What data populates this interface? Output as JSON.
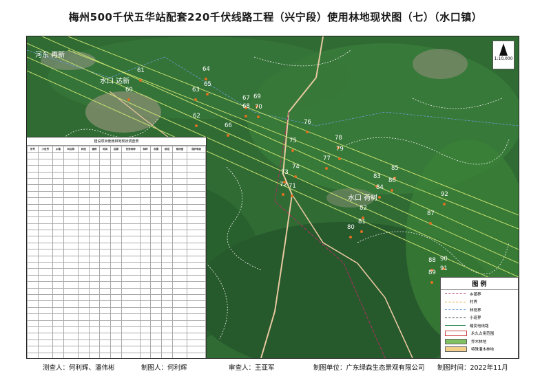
{
  "title": "梅州500千伏五华站配套220千伏线路工程（兴宁段）使用林地现状图（七）（水口镇）",
  "north_arrow": {
    "letter": "N",
    "scale": "1:10,000"
  },
  "places": [
    {
      "name": "河东 再新"
    },
    {
      "name": "水口 达新"
    },
    {
      "name": "水口 荷树"
    }
  ],
  "points": [
    "60",
    "61",
    "62",
    "63",
    "64",
    "65",
    "66",
    "67",
    "68",
    "69",
    "70",
    "71",
    "72",
    "73",
    "74",
    "75",
    "76",
    "77",
    "78",
    "79",
    "80",
    "81",
    "82",
    "83",
    "84",
    "85",
    "86",
    "87",
    "88",
    "89",
    "90",
    "91",
    "92"
  ],
  "table_caption": "建设项目使用林地现状调查表",
  "table_headers": [
    "序号",
    "小班号",
    "乡镇",
    "林业局",
    "林班",
    "面积",
    "地类",
    "起源",
    "优势树种",
    "林种",
    "权属",
    "龄组",
    "郁闭度",
    "保护等级"
  ],
  "legend": {
    "title": "图 例",
    "items": [
      {
        "label": "乡镇界",
        "color": "#b03060"
      },
      {
        "label": "村界",
        "color": "#e0a030"
      },
      {
        "label": "林班界",
        "color": "#6a9fd8"
      },
      {
        "label": "小班界",
        "color": "#333333"
      },
      {
        "label": "输变电线路",
        "color": "#2e8b57"
      },
      {
        "label": "永久占用范围",
        "color": "#d04040"
      },
      {
        "label": "乔木林地",
        "color": "#7fc060"
      },
      {
        "label": "特殊灌木林地",
        "color": "#f3d08a"
      }
    ]
  },
  "footer": {
    "survey": "测查人：何利辉、潘伟彬",
    "drawer": "制图人：何利辉",
    "reviewer": "审查人：王亚军",
    "unit": "制图单位：广东绿森生态景观有限公司",
    "date": "制图时间：2022年11月"
  },
  "colors": {
    "forest": "#2e6b32",
    "forest_dark": "#1f4f25",
    "line": "#c8e070",
    "road": "#e8c8a0"
  }
}
